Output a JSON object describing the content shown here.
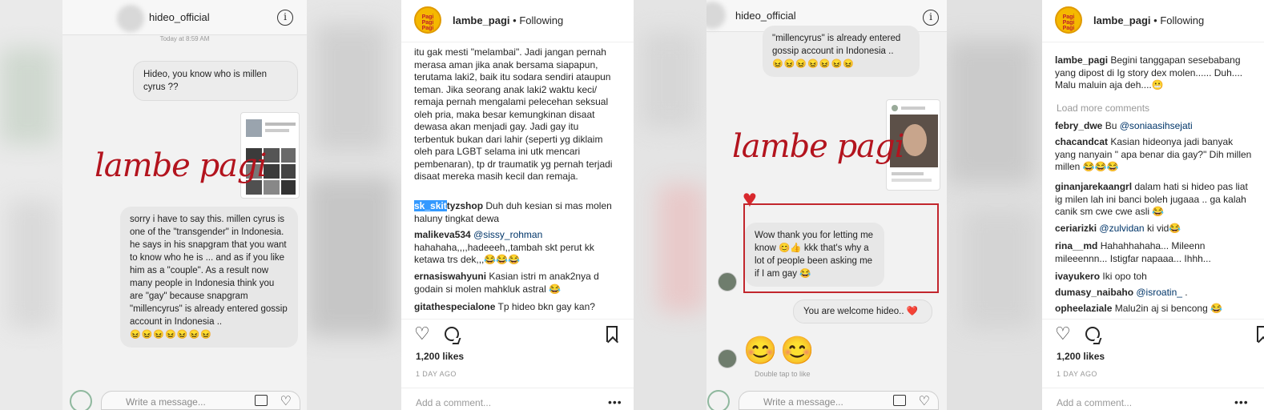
{
  "panel1": {
    "chat_name": "hideo_official",
    "timestamp": "Today at 8:59 AM",
    "msg_out": "Hideo, you know who is millen cyrus ??",
    "watermark": "lambe pagi",
    "msg_in": "sorry i have to say this. millen cyrus is one of the \"transgender\" in Indonesia. he says in his snapgram that you want to know who he is ... and as if you like him as a \"couple\". As a result now many people in Indonesia think you are \"gay\" because snapgram \"millencyrus\" is already entered gossip account in Indonesia ..",
    "msg_in_emojis": "😖😖😖😖😖😖😖",
    "composer_placeholder": "Write a message..."
  },
  "panel2": {
    "username": "lambe_pagi",
    "follow_state": "• Following",
    "caption_text": "itu gak mesti \"melambai\". Jadi jangan pernah merasa aman jika anak bersama siapapun, terutama laki2, baik itu sodara sendiri ataupun teman. Jika seorang anak laki2 waktu keci/ remaja pernah mengalami pelecehan seksual oleh pria, maka besar kemungkinan disaat dewasa akan menjadi gay. Jadi gay itu terbentuk bukan dari lahir (seperti yg diklaim oleh para LGBT selama ini utk mencari pembenaran), tp dr traumatik yg pernah terjadi disaat mereka masih kecil dan remaja.",
    "comments": [
      {
        "user_sel": "sk_skit",
        "user_rest": "tyzshop",
        "text": " Duh duh kesian si mas molen haluny tingkat dewa"
      },
      {
        "user": "malikeva534",
        "mention": " @sissy_rohman",
        "text": " hahahaha,,,,hadeeeh,,tambah skt perut kk ketawa trs dek,,,😂😂😂"
      },
      {
        "user": "ernasiswahyuni",
        "text": " Kasian istri m anak2nya d godain si molen mahkluk astral 😂"
      },
      {
        "user": "gitathespecialone",
        "text": " Tp hideo bkn gay kan?"
      }
    ],
    "likes": "1,200 likes",
    "ago": "1 DAY AGO",
    "add_comment": "Add a comment...",
    "more": "•••"
  },
  "panel3": {
    "chat_name": "hideo_official",
    "msg_in_top": "\"millencyrus\" is already entered gossip account in Indonesia ..",
    "msg_in_top_emojis": "😖😖😖😖😖😖😖",
    "watermark": "lambe pagi",
    "reply": "Wow thank you for letting me know 😊👍  kkk that's why a lot of people been asking me if I am gay 😂",
    "msg_out": "You are welcome hideo.. ❤️",
    "big_emojis": [
      "😊",
      "😊"
    ],
    "double_tap": "Double tap to like",
    "composer_placeholder": "Write a message..."
  },
  "panel4": {
    "username": "lambe_pagi",
    "follow_state": "• Following",
    "caption_user": "lambe_pagi",
    "caption_text": " Begini tanggapan sesebabang yang dipost di Ig story dex molen...... Duh.... Malu maluin aja deh....😬",
    "load_more": "Load more comments",
    "comments": [
      {
        "user": "febry_dwe",
        "text": " Bu ",
        "mention": "@soniaasihsejati"
      },
      {
        "user": "chacandcat",
        "text": " Kasian hideonya jadi banyak yang nanyain \" apa benar dia gay?\" Dih millen millen 😂😂😂"
      },
      {
        "user": "ginanjarekaangrl",
        "text": " dalam hati si hideo pas liat ig milen lah ini banci boleh jugaaa .. ga kalah canik sm cwe cwe asli 😂"
      },
      {
        "user": "ceriarizki",
        "text": " ",
        "mention": "@zulvidan",
        "after": " ki vid😂"
      },
      {
        "user": "rina__md",
        "text": " Hahahhahaha... Mileenn mileeennn... Istigfar napaaa... Ihhh..."
      },
      {
        "user": "ivayukero",
        "text": " Iki opo toh"
      },
      {
        "user": "dumasy_naibaho",
        "text": " ",
        "mention": "@isroatin_",
        "after": " ."
      },
      {
        "user": "opheelaziale",
        "text": " Malu2in aj si bencong 😂"
      }
    ],
    "likes": "1,200 likes",
    "ago": "1 DAY AGO",
    "add_comment": "Add a comment...",
    "more": "•••"
  }
}
